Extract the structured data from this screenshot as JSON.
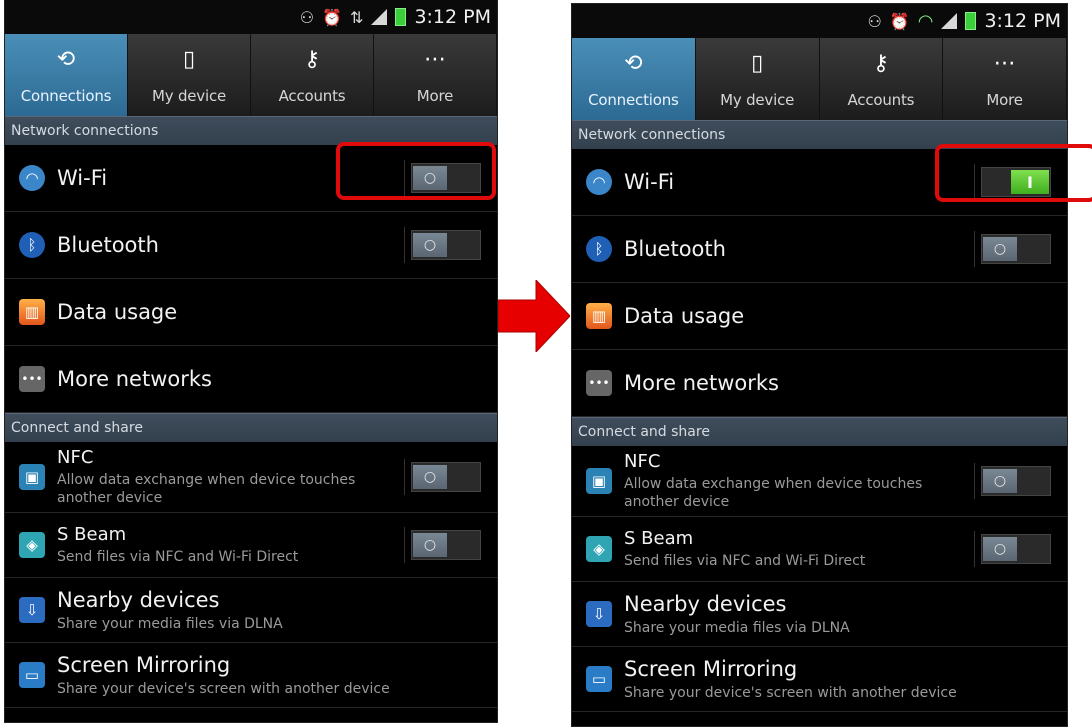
{
  "status_bar": {
    "time": "3:12 PM"
  },
  "tabs": [
    {
      "label": "Connections",
      "icon": "connections-icon",
      "active": true
    },
    {
      "label": "My device",
      "icon": "device-icon",
      "active": false
    },
    {
      "label": "Accounts",
      "icon": "key-icon",
      "active": false
    },
    {
      "label": "More",
      "icon": "more-icon",
      "active": false
    }
  ],
  "sections": {
    "network": "Network connections",
    "share": "Connect and share"
  },
  "rows": {
    "wifi": {
      "title": "Wi-Fi"
    },
    "bluetooth": {
      "title": "Bluetooth"
    },
    "data_usage": {
      "title": "Data usage"
    },
    "more_networks": {
      "title": "More networks"
    },
    "nfc": {
      "title": "NFC",
      "subtitle": "Allow data exchange when device touches another device"
    },
    "sbeam": {
      "title": "S Beam",
      "subtitle": "Send files via NFC and Wi-Fi Direct"
    },
    "nearby": {
      "title": "Nearby devices",
      "subtitle": "Share your media files via DLNA"
    },
    "mirroring": {
      "title": "Screen Mirroring",
      "subtitle": "Share your device's screen with another device"
    }
  },
  "toggle_states": {
    "left": {
      "wifi": "off",
      "bluetooth": "off",
      "nfc": "off",
      "sbeam": "off"
    },
    "right": {
      "wifi": "on",
      "bluetooth": "off",
      "nfc": "off",
      "sbeam": "off"
    }
  },
  "colors": {
    "highlight": "#e10a0a",
    "arrow": "#e60000",
    "toggle_on": "#5bc836",
    "tab_active": "#3b7ea8"
  }
}
